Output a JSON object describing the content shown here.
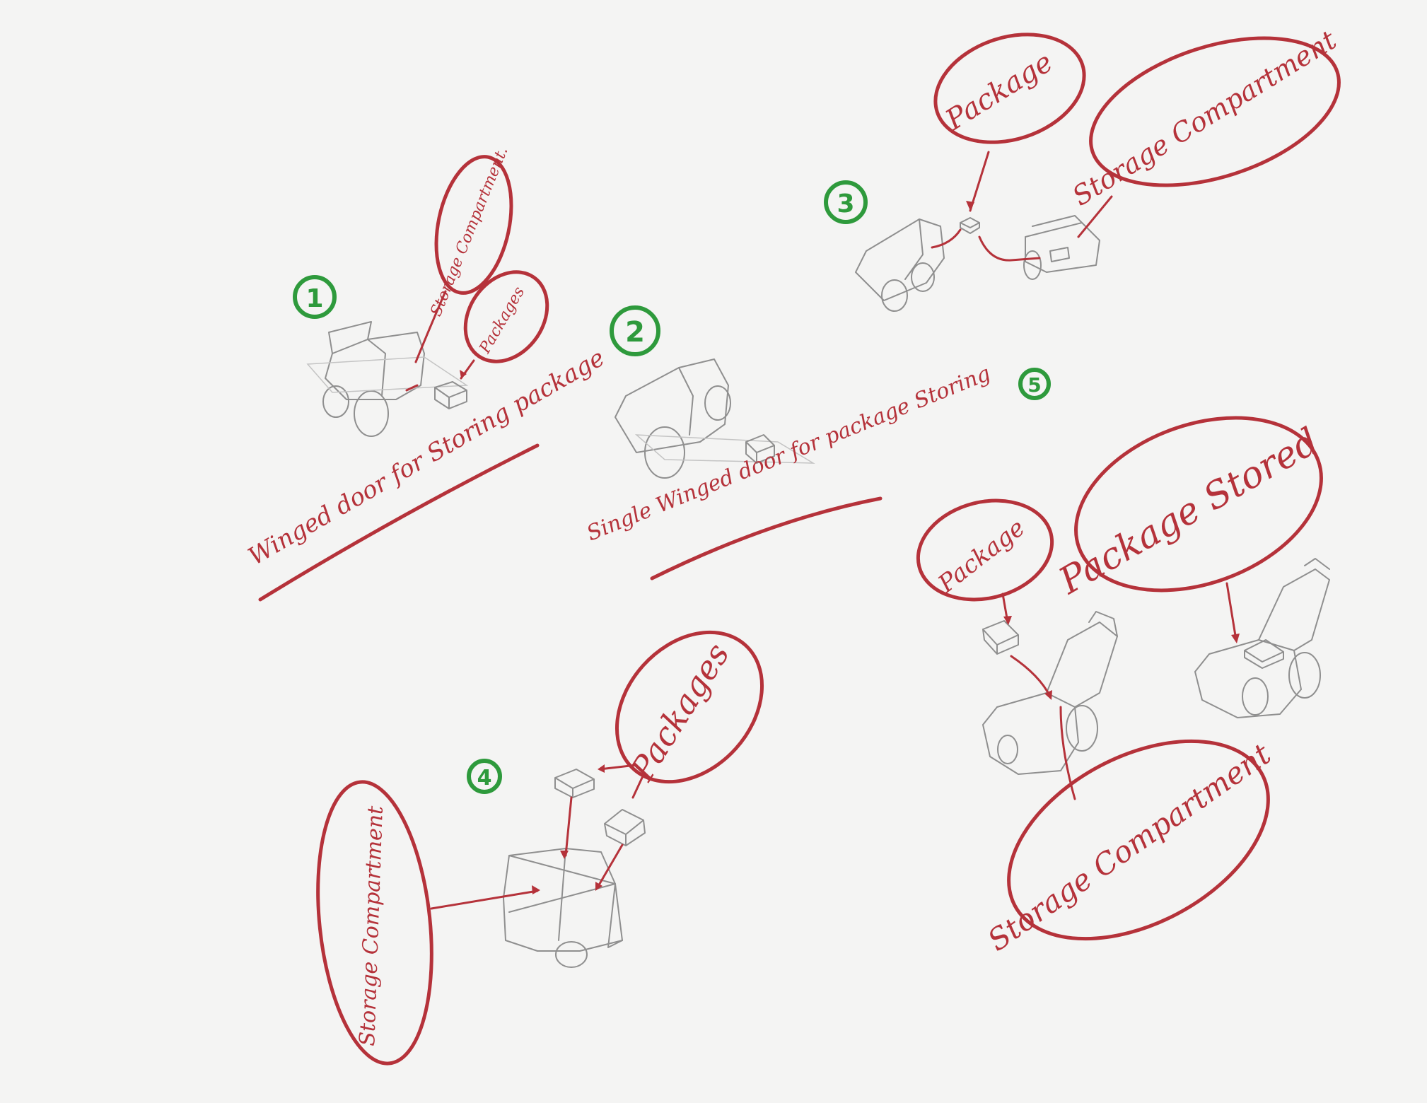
{
  "colors": {
    "ink": "#b5323a",
    "number": "#2e9a3c",
    "pencil": "#8f8f8f",
    "paper": "#f4f4f3"
  },
  "concept1": {
    "number": "1",
    "storage_label": "Storage Compartment.",
    "packages_label": "Packages",
    "caption": "Winged door for Storing package"
  },
  "concept2": {
    "number": "2",
    "caption": "Single Winged door for package Storing"
  },
  "concept3": {
    "number": "3",
    "package_label": "Package",
    "storage_label": "Storage Compartment"
  },
  "concept4": {
    "number": "4",
    "packages_label": "Packages",
    "storage_label": "Storage Compartment"
  },
  "concept5": {
    "number": "5",
    "package_label": "Package",
    "stored_label": "Package Stored",
    "storage_label": "Storage Compartment"
  }
}
